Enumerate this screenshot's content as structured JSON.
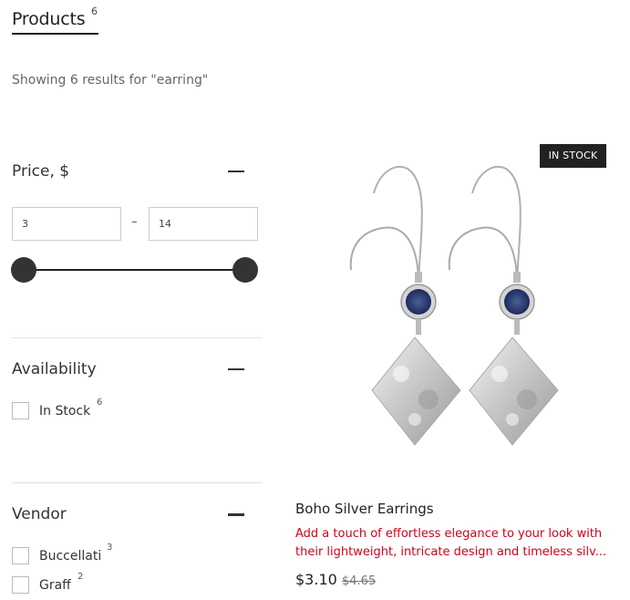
{
  "header": {
    "tab_label": "Products",
    "tab_count": "6"
  },
  "results": {
    "summary": "Showing 6 results for \"earring\""
  },
  "filters": {
    "price": {
      "title": "Price, $",
      "min_value": "3",
      "max_value": "14",
      "separator": "–",
      "range_min_fraction": 0,
      "range_max_fraction": 1
    },
    "availability": {
      "title": "Availability",
      "options": [
        {
          "label": "In Stock",
          "count": "6",
          "checked": false
        }
      ]
    },
    "vendor": {
      "title": "Vendor",
      "options": [
        {
          "label": "Buccellati",
          "count": "3",
          "checked": false
        },
        {
          "label": "Graff",
          "count": "2",
          "checked": false
        }
      ]
    }
  },
  "product": {
    "badge": "IN STOCK",
    "title": "Boho Silver Earrings",
    "description": "Add a touch of effortless elegance to your look with their lightweight, intricate design and timeless silv...",
    "price": "$3.10",
    "compare_price": "$4.65",
    "colors": {
      "description": "#d0021b",
      "badge_bg": "#222222",
      "stone": "#1e2b5c"
    }
  }
}
